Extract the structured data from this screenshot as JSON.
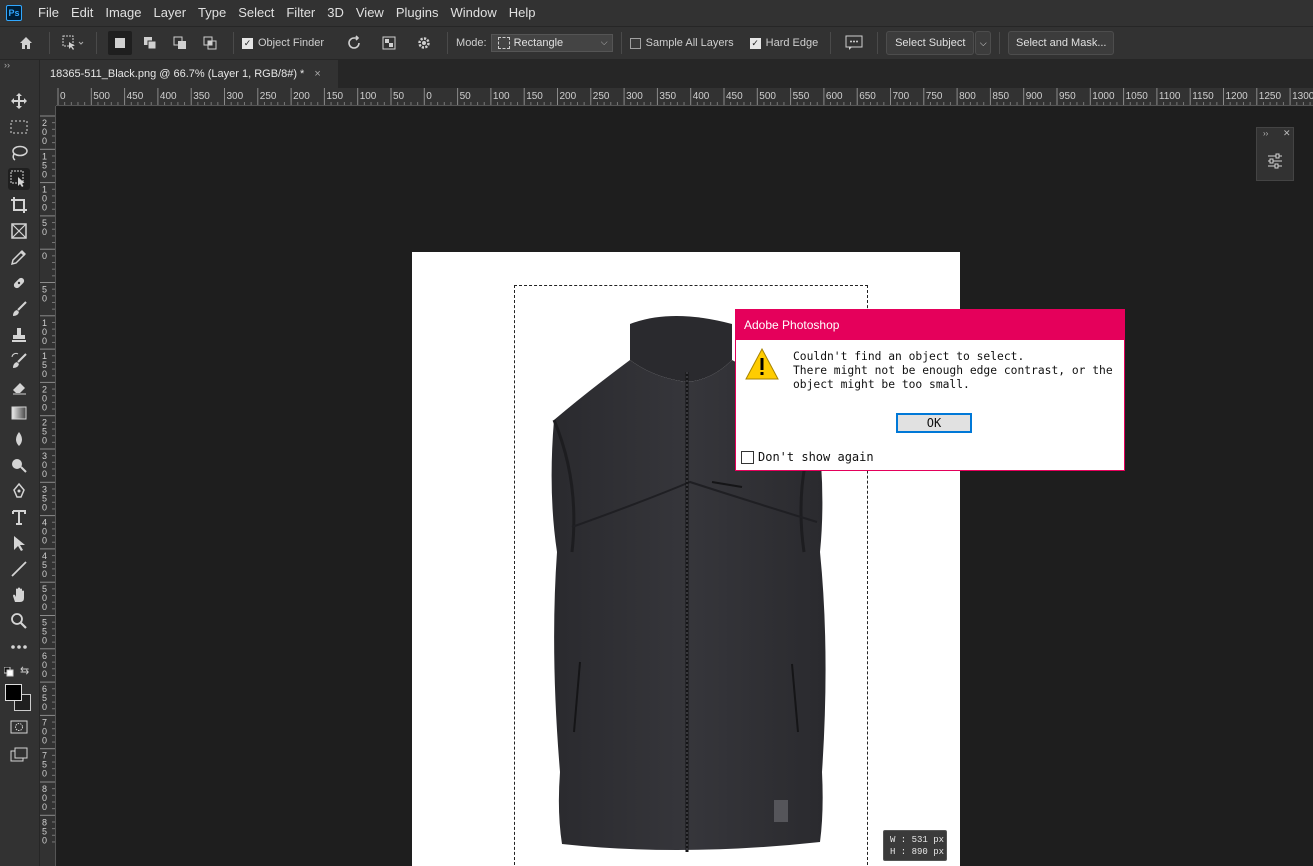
{
  "app": {
    "logo": "Ps"
  },
  "menu": [
    "File",
    "Edit",
    "Image",
    "Layer",
    "Type",
    "Select",
    "Filter",
    "3D",
    "View",
    "Plugins",
    "Window",
    "Help"
  ],
  "options": {
    "object_finder": "Object Finder",
    "mode_label": "Mode:",
    "mode_value": "Rectangle",
    "sample_all_layers": "Sample All Layers",
    "hard_edge": "Hard Edge",
    "select_subject": "Select Subject",
    "select_and_mask": "Select and Mask..."
  },
  "document_tab": {
    "title": "18365-511_Black.png @ 66.7% (Layer 1, RGB/8#) *",
    "close": "×"
  },
  "ruler_h": [
    "0",
    "500",
    "450",
    "400",
    "350",
    "300",
    "250",
    "200",
    "150",
    "100",
    "50",
    "0",
    "50",
    "100",
    "150",
    "200",
    "250",
    "300",
    "350",
    "400",
    "450",
    "500",
    "550",
    "600",
    "650",
    "700",
    "750",
    "800",
    "850",
    "900",
    "950",
    "1000",
    "1050",
    "1100",
    "1150",
    "1200",
    "1250",
    "1300"
  ],
  "ruler_v": [
    "2\n0\n0",
    "1\n5\n0",
    "1\n0\n0",
    "5\n0",
    "0",
    "5\n0",
    "1\n0\n0",
    "1\n5\n0",
    "2\n0\n0",
    "2\n5\n0",
    "3\n0\n0",
    "3\n5\n0",
    "4\n0\n0",
    "4\n5\n0",
    "5\n0\n0",
    "5\n5\n0",
    "6\n0\n0",
    "6\n5\n0",
    "7\n0\n0",
    "7\n5\n0",
    "8\n0\n0",
    "8\n5\n0"
  ],
  "dims": {
    "w": "W :  531 px",
    "h": "H :  890 px"
  },
  "dialog": {
    "title": "Adobe Photoshop",
    "line1": "Couldn't find an object to select.",
    "line2": "There might not be enough edge contrast, or the object might be too small.",
    "ok": "OK",
    "dont_show": "Don't show again"
  },
  "colors": {
    "dialog_accent": "#e5005b",
    "ps_blue": "#31a8ff"
  }
}
